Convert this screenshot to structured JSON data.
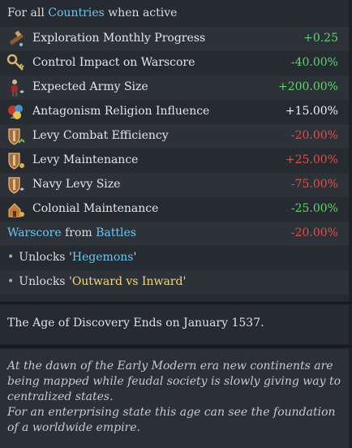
{
  "heading": {
    "prefix": "For all",
    "link": "Countries",
    "suffix": "when active"
  },
  "modifiers": [
    {
      "label": "Exploration Monthly Progress",
      "value": "+0.25",
      "icon": "spyglass-icon"
    },
    {
      "label": "Control Impact on Warscore",
      "value": "-40.00%",
      "icon": "key-icon"
    },
    {
      "label": "Expected Army Size",
      "value": "+200.00%",
      "icon": "soldier-icon"
    },
    {
      "label": "Antagonism Religion Influence",
      "value": "+15.00%",
      "icon": "religion-icon"
    },
    {
      "label": "Levy Combat Efficiency",
      "value": "-20.00%",
      "icon": "levy-shield-icon"
    },
    {
      "label": "Levy Maintenance",
      "value": "+25.00%",
      "icon": "levy-shield-icon"
    },
    {
      "label": "Navy Levy Size",
      "value": "-75.00%",
      "icon": "levy-shield-icon"
    },
    {
      "label": "Colonial Maintenance",
      "value": "-25.00%",
      "icon": "colony-icon"
    }
  ],
  "warscore": {
    "word1": "Warscore",
    "middle": "from",
    "word2": "Battles",
    "value": "-20.00%"
  },
  "unlocks": [
    {
      "prefix": "Unlocks",
      "quote_open": "'",
      "name": "Hegemons",
      "quote_close": "'"
    },
    {
      "prefix": "Unlocks",
      "quote_open": "'",
      "name": "Outward vs Inward",
      "quote_close": "'"
    }
  ],
  "ends_text": "The Age of Discovery Ends on January 1537.",
  "description": [
    "At the dawn of the Early Modern era new continents are being mapped while feudal society is slowly giving way to centralized states.",
    "For an enterprising state this age can see the foundation of a worldwide empire."
  ],
  "colors": {
    "positive": "#63d36c",
    "negative": "#e0504b",
    "neutral": "#f0f0f0",
    "link": "#6fc5ef",
    "highlight": "#f5d67a"
  }
}
